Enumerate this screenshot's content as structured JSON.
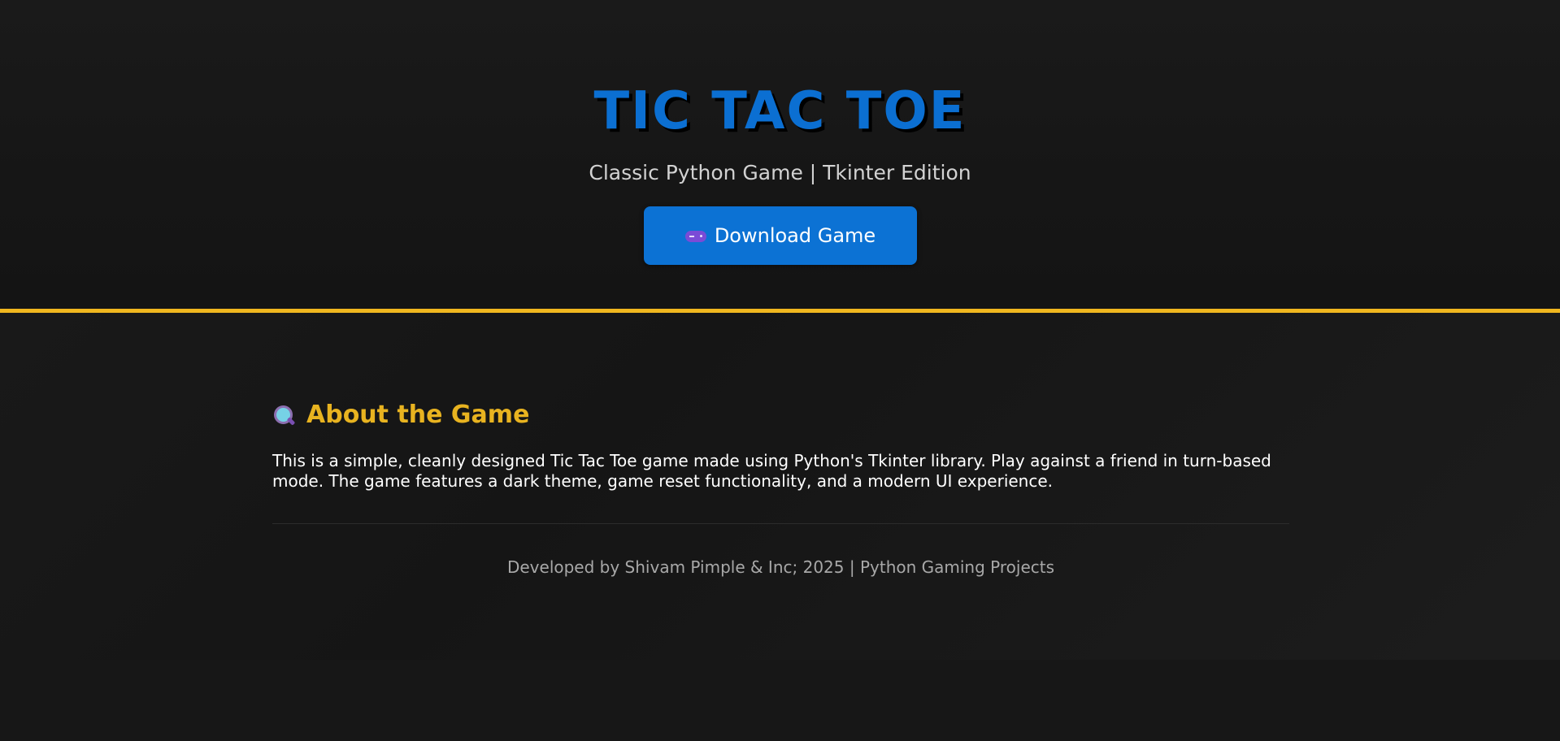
{
  "hero": {
    "title": "TIC TAC TOE",
    "subtitle": "Classic Python Game | Tkinter Edition",
    "download_label": "Download Game",
    "download_icon": "gamepad-icon"
  },
  "about": {
    "icon": "magnifying-glass-icon",
    "heading": "About the Game",
    "body": "This is a simple, cleanly designed Tic Tac Toe game made using Python's Tkinter library. Play against a friend in turn-based mode. The game features a dark theme, game reset functionality, and a modern UI experience."
  },
  "footer": {
    "text": "Developed by Shivam Pimple & Inc; 2025 | Python Gaming Projects"
  },
  "colors": {
    "accent_blue": "#0c72d4",
    "accent_yellow": "#f0b71f",
    "background": "#181818"
  }
}
